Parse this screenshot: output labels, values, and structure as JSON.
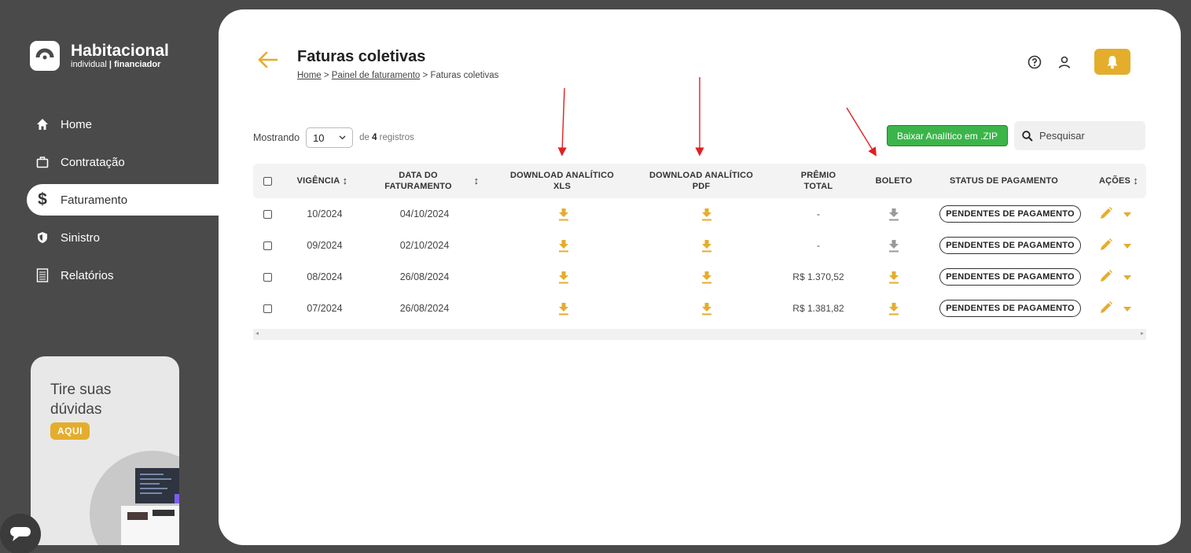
{
  "brand": {
    "title": "Habitacional",
    "sub_left": "individual",
    "sub_sep": " | ",
    "sub_right": "financiador"
  },
  "nav": [
    {
      "label": "Home",
      "icon": "home-icon"
    },
    {
      "label": "Contratação",
      "icon": "briefcase-icon"
    },
    {
      "label": "Faturamento",
      "icon": "dollar-icon"
    },
    {
      "label": "Sinistro",
      "icon": "shield-icon"
    },
    {
      "label": "Relatórios",
      "icon": "report-icon"
    }
  ],
  "help": {
    "line1": "Tire suas",
    "line2": "dúvidas",
    "button": "AQUI"
  },
  "header": {
    "title": "Faturas coletivas",
    "crumbs": {
      "home": "Home",
      "sep1": " > ",
      "billing": "Painel de faturamento",
      "sep2": " > ",
      "current": "Faturas coletivas"
    }
  },
  "controls": {
    "showing": "Mostrando",
    "page_size": "10",
    "of_prefix": "de ",
    "count": "4",
    "of_suffix": " registros",
    "zip_button": "Baixar Analítico em .ZIP",
    "search_placeholder": "Pesquisar"
  },
  "columns": {
    "vigencia": "VIGÊNCIA",
    "data1": "DATA DO",
    "data2": "FATURAMENTO",
    "xls1": "DOWNLOAD ANALÍTICO",
    "xls2": "XLS",
    "pdf1": "DOWNLOAD ANALÍTICO",
    "pdf2": "PDF",
    "premio1": "PRÊMIO",
    "premio2": "TOTAL",
    "boleto": "BOLETO",
    "status": "STATUS DE PAGAMENTO",
    "acoes": "AÇÕES"
  },
  "rows": [
    {
      "vigencia": "10/2024",
      "data": "04/10/2024",
      "premio": "-",
      "boleto_enabled": false,
      "status": "PENDENTES DE PAGAMENTO"
    },
    {
      "vigencia": "09/2024",
      "data": "02/10/2024",
      "premio": "-",
      "boleto_enabled": false,
      "status": "PENDENTES DE PAGAMENTO"
    },
    {
      "vigencia": "08/2024",
      "data": "26/08/2024",
      "premio": "R$ 1.370,52",
      "boleto_enabled": true,
      "status": "PENDENTES DE PAGAMENTO"
    },
    {
      "vigencia": "07/2024",
      "data": "26/08/2024",
      "premio": "R$ 1.381,82",
      "boleto_enabled": true,
      "status": "PENDENTES DE PAGAMENTO"
    }
  ],
  "colors": {
    "accent": "#e4ad2c",
    "green": "#3bb54a",
    "disabled": "#9a9a9a",
    "annotation": "#e02020"
  }
}
